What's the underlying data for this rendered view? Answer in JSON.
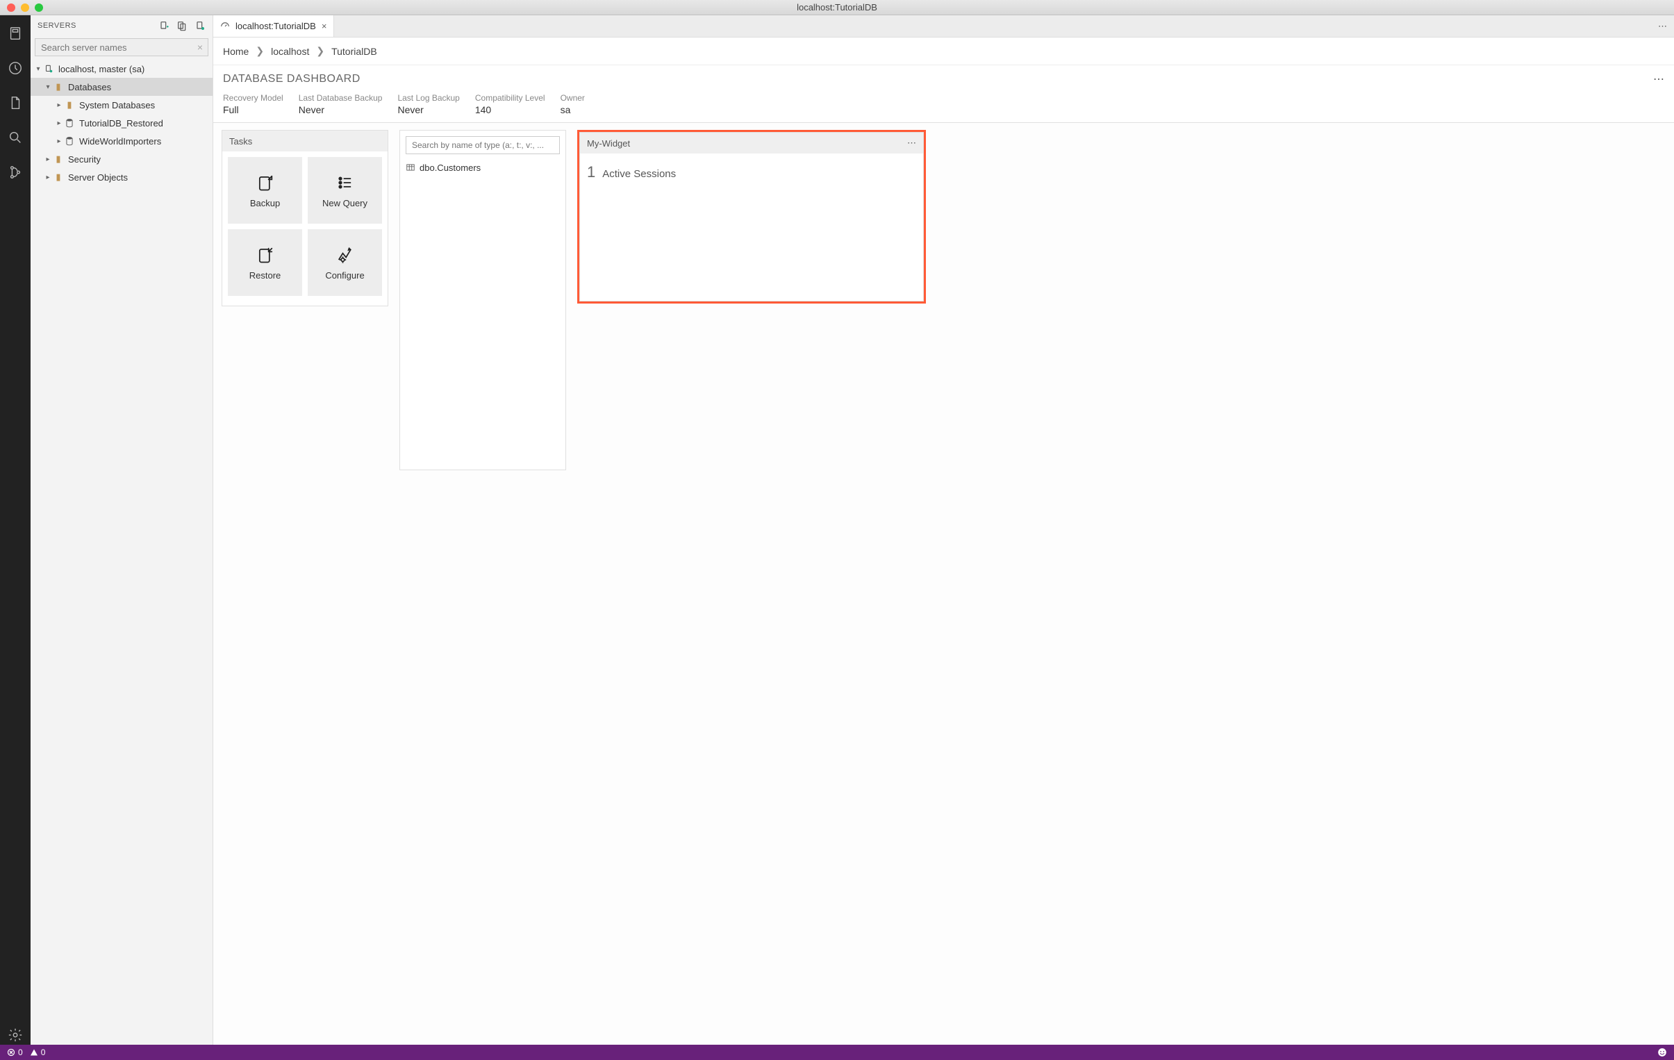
{
  "window": {
    "title": "localhost:TutorialDB"
  },
  "sidebar": {
    "title": "SERVERS",
    "search_placeholder": "Search server names",
    "tree": {
      "server": "localhost, master (sa)",
      "databases_label": "Databases",
      "items": [
        "System Databases",
        "TutorialDB_Restored",
        "WideWorldImporters"
      ],
      "security_label": "Security",
      "server_objects_label": "Server Objects"
    }
  },
  "tab": {
    "title": "localhost:TutorialDB"
  },
  "breadcrumb": [
    "Home",
    "localhost",
    "TutorialDB"
  ],
  "dashboard": {
    "title": "DATABASE DASHBOARD",
    "props": [
      {
        "label": "Recovery Model",
        "value": "Full"
      },
      {
        "label": "Last Database Backup",
        "value": "Never"
      },
      {
        "label": "Last Log Backup",
        "value": "Never"
      },
      {
        "label": "Compatibility Level",
        "value": "140"
      },
      {
        "label": "Owner",
        "value": "sa"
      }
    ]
  },
  "tasks": {
    "title": "Tasks",
    "buttons": [
      "Backup",
      "New Query",
      "Restore",
      "Configure"
    ]
  },
  "objects": {
    "search_placeholder": "Search by name of type (a:, t:, v:, ...",
    "rows": [
      "dbo.Customers"
    ]
  },
  "my_widget": {
    "title": "My-Widget",
    "number": "1",
    "label": "Active Sessions"
  },
  "status": {
    "errors": "0",
    "warnings": "0"
  }
}
